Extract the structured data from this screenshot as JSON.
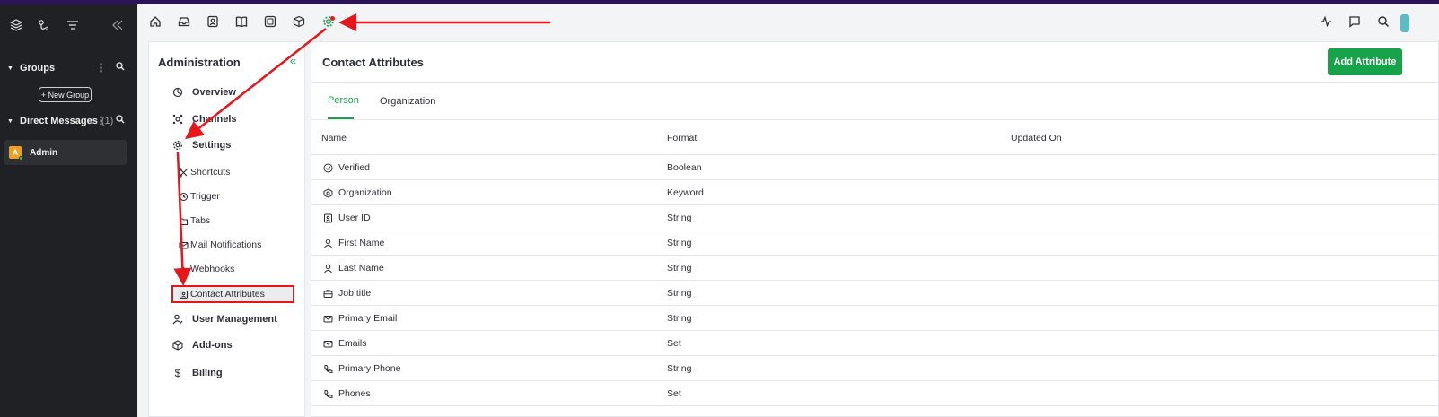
{
  "sidebar": {
    "icons": [
      "layers-icon",
      "route-icon",
      "filter-icon",
      "collapse-double-left-icon"
    ],
    "groups_label": "Groups",
    "new_group_label": "+ New Group",
    "direct_messages_label": "Direct Messages",
    "direct_messages_count": "(1)",
    "admin_initial": "A",
    "admin_name": "Admin"
  },
  "topnav": {
    "left_icons": [
      "home-icon",
      "inbox-icon",
      "contacts-icon",
      "knowledge-book-icon",
      "reports-icon",
      "apps-cube-icon",
      "settings-gear-icon"
    ],
    "right_icons": [
      "activity-icon",
      "chat-icon",
      "search-icon"
    ]
  },
  "admin_panel": {
    "title": "Administration",
    "items": [
      {
        "label": "Overview",
        "icon": "overview-icon"
      },
      {
        "label": "Channels",
        "icon": "channels-icon"
      },
      {
        "label": "Settings",
        "icon": "settings-icon"
      },
      {
        "label": "User Management",
        "icon": "user-management-icon"
      },
      {
        "label": "Add-ons",
        "icon": "addons-icon"
      },
      {
        "label": "Billing",
        "icon": "billing-dollar-icon"
      }
    ],
    "settings_sub": [
      {
        "label": "Shortcuts",
        "icon": "shortcuts-icon"
      },
      {
        "label": "Trigger",
        "icon": "trigger-icon"
      },
      {
        "label": "Tabs",
        "icon": "tabs-icon"
      },
      {
        "label": "Mail Notifications",
        "icon": "mail-notifications-icon"
      },
      {
        "label": "Webhooks",
        "icon": "webhooks-icon"
      },
      {
        "label": "Contact Attributes",
        "icon": "contact-attributes-icon"
      }
    ]
  },
  "main": {
    "title": "Contact Attributes",
    "add_button": "Add Attribute",
    "tabs": [
      {
        "label": "Person",
        "active": true
      },
      {
        "label": "Organization",
        "active": false
      }
    ],
    "columns": [
      "Name",
      "Format",
      "Updated On"
    ],
    "rows": [
      {
        "name": "Verified",
        "format": "Boolean",
        "icon": "check-circle-icon"
      },
      {
        "name": "Organization",
        "format": "Keyword",
        "icon": "organization-icon"
      },
      {
        "name": "User ID",
        "format": "String",
        "icon": "id-badge-icon"
      },
      {
        "name": "First Name",
        "format": "String",
        "icon": "user-icon"
      },
      {
        "name": "Last Name",
        "format": "String",
        "icon": "user-icon"
      },
      {
        "name": "Job title",
        "format": "String",
        "icon": "briefcase-icon"
      },
      {
        "name": "Primary Email",
        "format": "String",
        "icon": "mail-icon"
      },
      {
        "name": "Emails",
        "format": "Set",
        "icon": "mail-icon"
      },
      {
        "name": "Primary Phone",
        "format": "String",
        "icon": "phone-icon"
      },
      {
        "name": "Phones",
        "format": "Set",
        "icon": "phone-icon"
      }
    ]
  },
  "colors": {
    "accent_green": "#17a34a",
    "annotation_red": "#e8151b",
    "dark_sidebar": "#1f2124"
  }
}
